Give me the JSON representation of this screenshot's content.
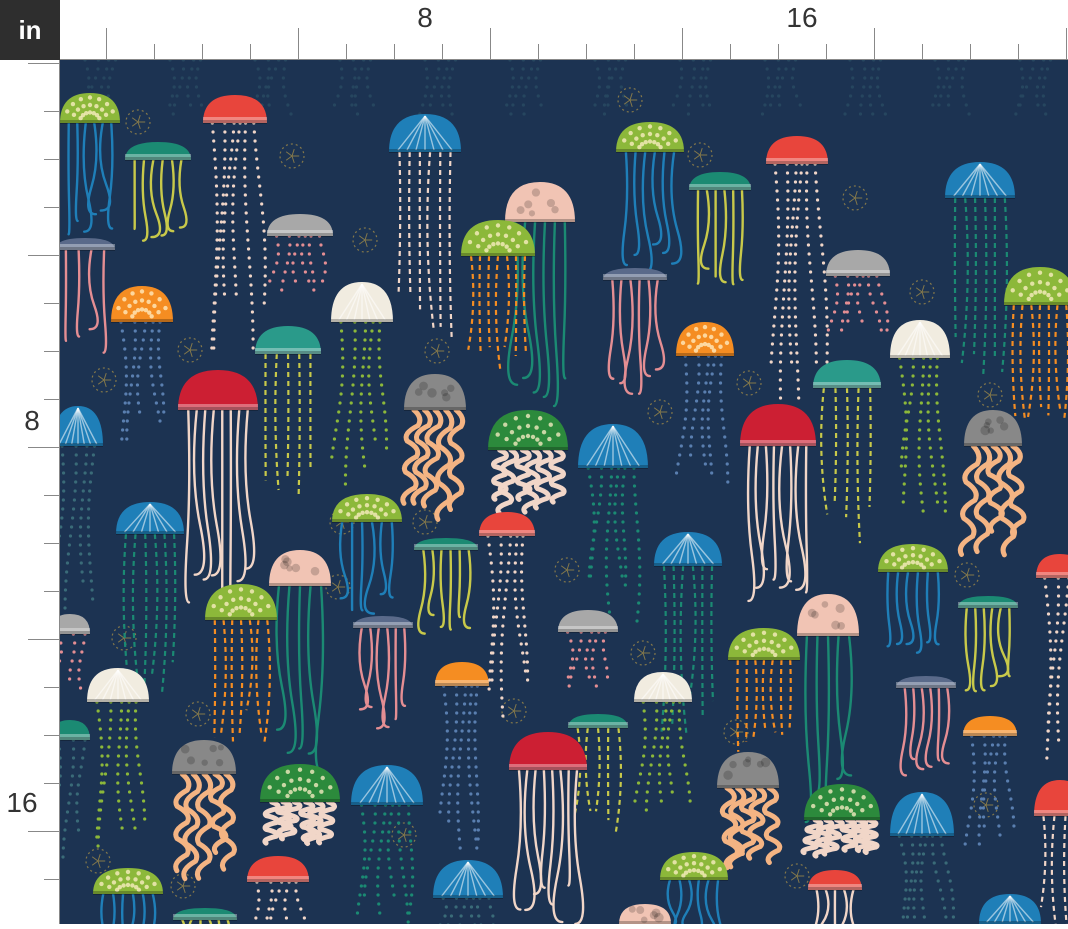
{
  "ruler": {
    "unit": "in",
    "top_labels": [
      "8",
      "16"
    ],
    "left_labels": [
      "8",
      "16"
    ]
  },
  "colors": {
    "background": "#1c3352",
    "ruler_bg": "#ffffff",
    "ruler_line": "#888888",
    "corner_bg": "#2e2e2e"
  },
  "fabric": {
    "pattern": "jellyfish",
    "palette": [
      "#e8453c",
      "#1f7fb8",
      "#8cb83a",
      "#1b8a73",
      "#f58d22",
      "#f1d6c8",
      "#cc1f33",
      "#a8a8a8",
      "#888",
      "#e48e93",
      "#2a9a8a",
      "#f4b483"
    ]
  }
}
